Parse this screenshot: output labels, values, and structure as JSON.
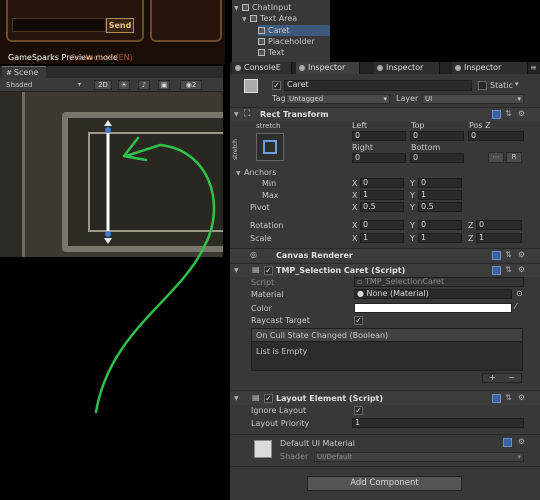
{
  "game": {
    "send_label": "Send",
    "preview_label": "GameSparks Preview mode",
    "contact_label": "Contact us (EN)"
  },
  "hierarchy": {
    "items": [
      {
        "label": "ChatInput",
        "selected": false
      },
      {
        "label": "Text Area",
        "selected": false
      },
      {
        "label": "Caret",
        "selected": true
      },
      {
        "label": "Placeholder",
        "selected": false
      },
      {
        "label": "Text",
        "selected": false
      }
    ]
  },
  "scene": {
    "tab_label": "Scene",
    "shading": "Shaded",
    "mode_2d": "2D",
    "gizmo_count": "2"
  },
  "inspector": {
    "tabs": [
      "ConsoleE",
      "Inspector",
      "Inspector",
      "Inspector"
    ],
    "object_name": "Caret",
    "static_label": "Static",
    "tag_label": "Tag",
    "tag_value": "Untagged",
    "layer_label": "Layer",
    "layer_value": "UI",
    "rect_transform": {
      "title": "Rect Transform",
      "anchor_preset": "stretch",
      "anchor_preset_side": "stretch",
      "headers": [
        "Left",
        "Top",
        "Pos Z",
        "Right",
        "Bottom"
      ],
      "left": "0",
      "top": "0",
      "pos_z": "0",
      "right": "0",
      "bottom": "0",
      "r_button": "R",
      "anchors_label": "Anchors",
      "min_label": "Min",
      "max_label": "Max",
      "min_x": "0",
      "min_y": "0",
      "max_x": "1",
      "max_y": "1",
      "pivot_label": "Pivot",
      "pivot_x": "0.5",
      "pivot_y": "0.5",
      "rotation_label": "Rotation",
      "rot_x": "0",
      "rot_y": "0",
      "rot_z": "0",
      "scale_label": "Scale",
      "scale_x": "1",
      "scale_y": "1",
      "scale_z": "1",
      "axis_x": "X",
      "axis_y": "Y",
      "axis_z": "Z"
    },
    "canvas_renderer": {
      "title": "Canvas Renderer"
    },
    "selection_caret": {
      "title": "TMP_Selection Caret (Script)",
      "script_label": "Script",
      "script_value": "TMP_SelectionCaret",
      "material_label": "Material",
      "material_value": "None (Material)",
      "color_label": "Color",
      "raycast_label": "Raycast Target",
      "event_header": "On Cull State Changed (Boolean)",
      "event_empty": "List is Empty",
      "plus": "+",
      "minus": "−"
    },
    "layout_element": {
      "title": "Layout Element (Script)",
      "ignore_label": "Ignore Layout",
      "priority_label": "Layout Priority",
      "priority_value": "1"
    },
    "material": {
      "name": "Default UI Material",
      "shader_label": "Shader",
      "shader_value": "UI/Default"
    },
    "add_component_label": "Add Component"
  },
  "colors": {
    "arrow": "#2ec24a",
    "caret": "#ffffff",
    "handle": "#3a7bd5",
    "selection": "#3d5a7a"
  }
}
